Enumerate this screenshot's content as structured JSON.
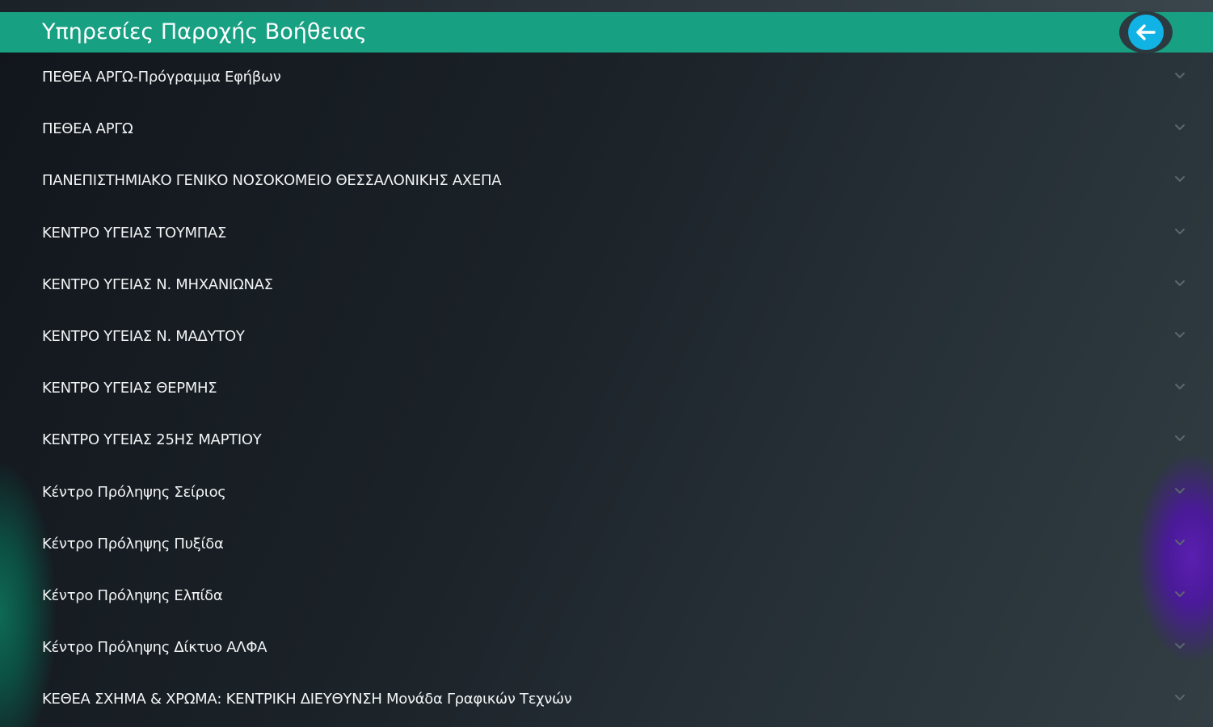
{
  "header": {
    "title": "Υπηρεσίες Παροχής Βοήθειας",
    "back_icon": "arrow-left-icon",
    "accent_color": "#18a083",
    "back_color": "#11b3e4"
  },
  "list": {
    "expand_icon": "chevron-down-icon",
    "items": [
      {
        "label": "ΠΕΘΕΑ ΑΡΓΩ-Πρόγραμμα Εφήβων"
      },
      {
        "label": "ΠΕΘΕΑ ΑΡΓΩ"
      },
      {
        "label": "ΠΑΝΕΠΙΣΤΗΜΙΑΚΟ ΓΕΝΙΚΟ ΝΟΣΟΚΟΜΕΙΟ ΘΕΣΣΑΛΟΝΙΚΗΣ ΑΧΕΠΑ"
      },
      {
        "label": "ΚΕΝΤΡΟ ΥΓΕΙΑΣ ΤΟΥΜΠΑΣ"
      },
      {
        "label": "ΚΕΝΤΡΟ ΥΓΕΙΑΣ Ν. ΜΗΧΑΝΙΩΝΑΣ"
      },
      {
        "label": "ΚΕΝΤΡΟ ΥΓΕΙΑΣ Ν. ΜΑΔΥΤΟΥ"
      },
      {
        "label": "ΚΕΝΤΡΟ ΥΓΕΙΑΣ ΘΕΡΜΗΣ"
      },
      {
        "label": "ΚΕΝΤΡΟ ΥΓΕΙΑΣ 25ΗΣ ΜΑΡΤΙΟΥ"
      },
      {
        "label": "Κέντρο Πρόληψης Σείριος"
      },
      {
        "label": "Κέντρο Πρόληψης Πυξίδα"
      },
      {
        "label": "Κέντρο Πρόληψης Ελπίδα"
      },
      {
        "label": "Κέντρο Πρόληψης Δίκτυο ΑΛΦΑ"
      },
      {
        "label": "ΚΕΘΕΑ ΣΧΗΜΑ & ΧΡΩΜΑ: ΚΕΝΤΡΙΚΗ ΔΙΕΥΘΥΝΣΗ Μονάδα Γραφικών Τεχνών"
      }
    ]
  }
}
